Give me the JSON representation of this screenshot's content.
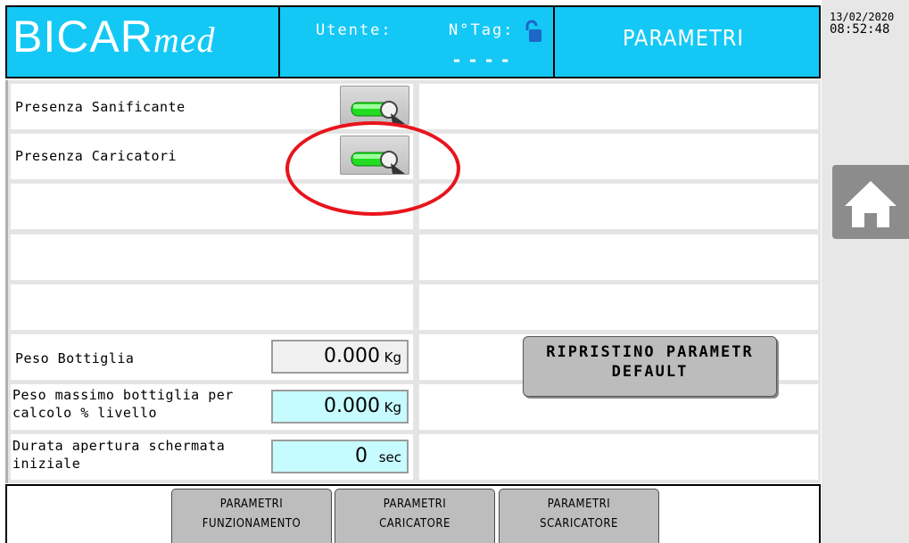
{
  "header": {
    "logo_main": "BICAR",
    "logo_sub": "med",
    "user_label": "Utente:",
    "tag_label": "N°Tag:",
    "tag_value": "----",
    "page_title": "PARAMETRI"
  },
  "datetime": {
    "date": "13/02/2020",
    "time": "08:52:48"
  },
  "rows": {
    "sanificante": {
      "label": "Presenza Sanificante",
      "on": true
    },
    "caricatori": {
      "label": "Presenza Caricatori",
      "on": true
    },
    "peso_bottiglia": {
      "label": "Peso Bottiglia",
      "value": "0.000",
      "unit": "Kg"
    },
    "peso_massimo": {
      "label_1": "Peso massimo bottiglia per",
      "label_2": "calcolo % livello",
      "value": "0.000",
      "unit": "Kg"
    },
    "durata_apertura": {
      "label_1": "Durata apertura schermata",
      "label_2": "iniziale",
      "value": "0",
      "unit": "sec"
    }
  },
  "reset_button": {
    "line_1": "RIPRISTINO PARAMETR",
    "line_2": "DEFAULT"
  },
  "tabs": [
    {
      "line_1": "PARAMETRI",
      "line_2": "FUNZIONAMENTO"
    },
    {
      "line_1": "PARAMETRI",
      "line_2": "CARICATORE"
    },
    {
      "line_1": "PARAMETRI",
      "line_2": "SCARICATORE"
    }
  ],
  "icons": {
    "home": "home-icon",
    "lock": "unlocked-padlock-icon",
    "toggle": "toggle-switch-icon"
  },
  "colors": {
    "header": "#14c8f5",
    "toggle_on": "#22dd22",
    "annotation": "#e8141c",
    "field_cyan": "#c6fbff"
  }
}
